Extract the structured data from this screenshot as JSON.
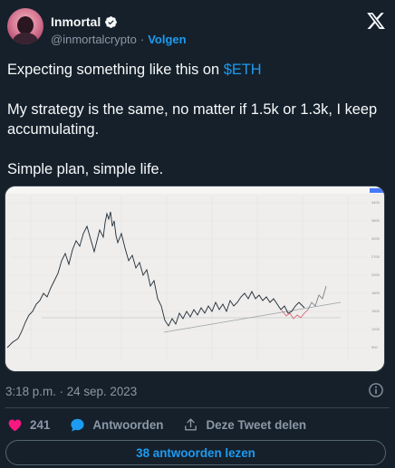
{
  "author": {
    "display_name": "Inmortal",
    "handle": "@inmortalcrypto",
    "separator": "·",
    "follow_label": "Volgen"
  },
  "tweet": {
    "line1_prefix": "Expecting something like this on ",
    "cashtag": "$ETH",
    "paragraph2": "My strategy is the same, no matter if 1.5k or 1.3k, I keep accumulating.",
    "paragraph3": "Simple plan, simple life."
  },
  "timestamp": "3:18 p.m. · 24 sep. 2023",
  "actions": {
    "like_count": "241",
    "reply_label": "Antwoorden",
    "share_label": "Deze Tweet delen"
  },
  "read_replies_label": "38 antwoorden lezen",
  "colors": {
    "background": "#15202b",
    "accent": "#1d9bf0",
    "like": "#f91880",
    "muted": "#8b98a5"
  },
  "icons": [
    "verified-badge-icon",
    "x-logo-icon",
    "info-icon",
    "heart-icon",
    "reply-bubble-icon",
    "share-icon"
  ]
}
